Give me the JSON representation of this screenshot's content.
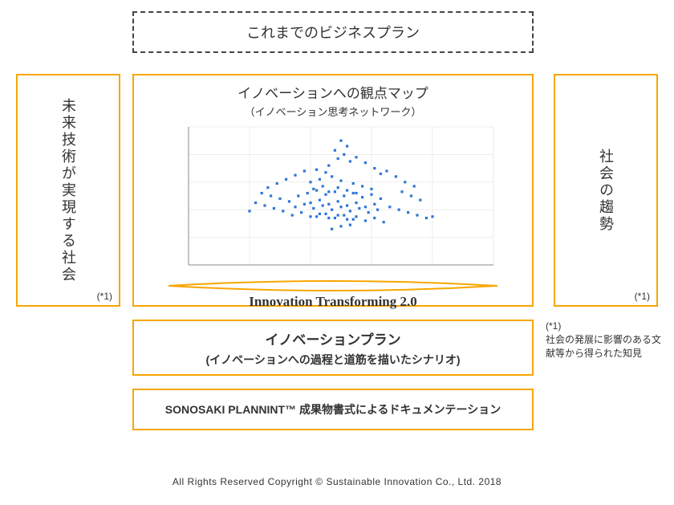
{
  "top": {
    "label": "これまでのビジネスプラン"
  },
  "side": {
    "left_label": "未来技術が実現する社会",
    "right_label": "社会の趨勢",
    "note": "(*1)"
  },
  "center": {
    "title": "イノベーションへの観点マップ",
    "subtitle": "（イノベーション思考ネットワーク）",
    "footer": "Innovation Transforming 2.0"
  },
  "plan": {
    "title": "イノベーションプラン",
    "subtitle": "(イノベーションへの過程と道筋を描いたシナリオ)"
  },
  "doc": {
    "label": "SONOSAKI PLANNINT™ 成果物書式によるドキュメンテーション"
  },
  "footnote": {
    "marker": "(*1)",
    "text": "社会の発展に影響のある文献等から得られた知見"
  },
  "copyright": "All Rights Reserved Copyright © Sustainable Innovation Co., Ltd. 2018",
  "chart_data": {
    "type": "scatter",
    "title": "イノベーションへの観点マップ",
    "xlabel": "",
    "ylabel": "",
    "xlim": [
      0,
      10
    ],
    "ylim": [
      0,
      10
    ],
    "series": [
      {
        "name": "points",
        "x": [
          5.0,
          5.2,
          4.8,
          5.1,
          4.9,
          5.3,
          4.6,
          4.2,
          4.5,
          5.5,
          5.8,
          6.1,
          6.3,
          3.8,
          3.5,
          3.2,
          2.9,
          2.6,
          6.5,
          6.8,
          7.1,
          7.4,
          4.0,
          4.3,
          4.7,
          5.0,
          5.4,
          5.7,
          6.0,
          4.1,
          4.4,
          4.6,
          4.9,
          5.2,
          5.5,
          3.6,
          3.9,
          4.2,
          4.5,
          4.8,
          5.1,
          5.4,
          5.7,
          6.0,
          6.3,
          2.4,
          2.7,
          3.0,
          3.3,
          7.0,
          7.3,
          7.6,
          4.0,
          4.3,
          4.6,
          4.9,
          5.2,
          5.5,
          5.8,
          6.1,
          3.5,
          3.8,
          4.1,
          4.4,
          4.7,
          5.0,
          5.3,
          5.6,
          5.9,
          6.2,
          2.2,
          2.5,
          2.8,
          3.1,
          6.6,
          6.9,
          7.2,
          7.5,
          7.8,
          4.2,
          4.5,
          4.8,
          5.1,
          5.4,
          3.4,
          3.7,
          4.0,
          4.3,
          4.6,
          4.9,
          5.2,
          5.5,
          5.8,
          6.1,
          6.4,
          2.0,
          8.0,
          5.0,
          4.7,
          5.3
        ],
        "y": [
          9.0,
          8.6,
          8.3,
          8.0,
          7.7,
          7.5,
          7.2,
          6.9,
          6.7,
          7.8,
          7.4,
          7.0,
          6.6,
          6.8,
          6.5,
          6.2,
          5.9,
          5.6,
          6.8,
          6.4,
          6.0,
          5.7,
          6.0,
          6.2,
          6.4,
          6.1,
          5.9,
          5.7,
          5.5,
          5.5,
          5.7,
          5.3,
          5.6,
          5.4,
          5.2,
          5.0,
          5.2,
          5.4,
          5.1,
          5.3,
          5.0,
          5.2,
          4.9,
          5.1,
          4.8,
          5.2,
          5.0,
          4.8,
          4.6,
          5.3,
          5.0,
          4.7,
          4.5,
          4.7,
          4.4,
          4.6,
          4.3,
          4.5,
          4.2,
          4.4,
          4.2,
          4.4,
          4.1,
          4.3,
          4.0,
          4.2,
          3.9,
          4.1,
          3.8,
          4.0,
          4.5,
          4.3,
          4.1,
          3.9,
          4.2,
          4.0,
          3.8,
          3.6,
          3.4,
          3.5,
          3.7,
          3.4,
          3.6,
          3.3,
          3.6,
          3.8,
          3.5,
          3.7,
          3.4,
          3.6,
          3.3,
          3.5,
          3.2,
          3.4,
          3.1,
          3.9,
          3.5,
          2.8,
          2.6,
          2.9
        ]
      }
    ]
  }
}
